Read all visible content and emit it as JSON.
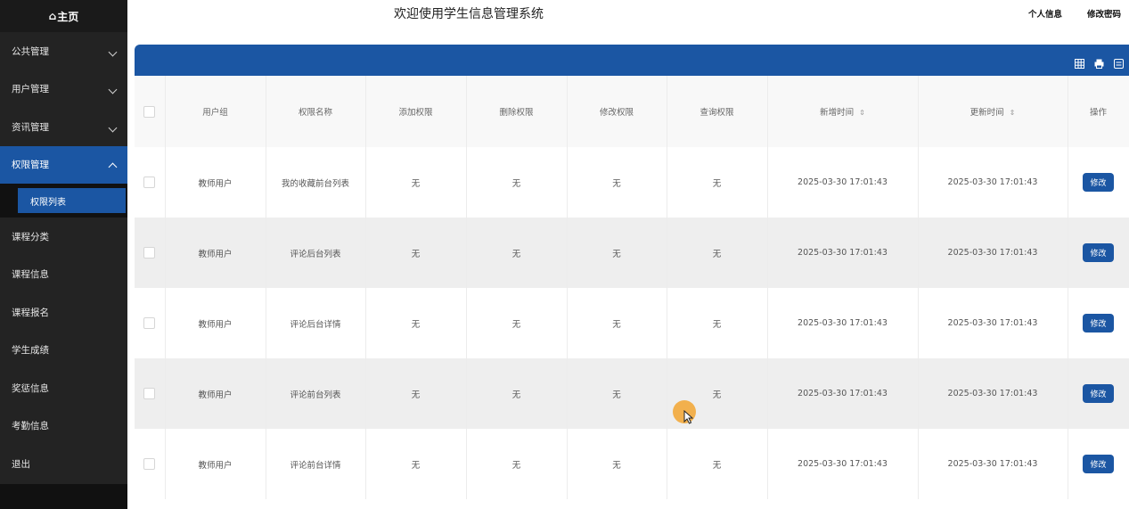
{
  "sidebar": {
    "brand": "主页",
    "menus": [
      {
        "label": "公共管理"
      },
      {
        "label": "用户管理"
      },
      {
        "label": "资讯管理"
      },
      {
        "label": "权限管理"
      }
    ],
    "submenu_active": "权限列表",
    "plain_items": [
      {
        "label": "课程分类"
      },
      {
        "label": "课程信息"
      },
      {
        "label": "课程报名"
      },
      {
        "label": "学生成绩"
      },
      {
        "label": "奖惩信息"
      },
      {
        "label": "考勤信息"
      },
      {
        "label": "退出"
      }
    ]
  },
  "header": {
    "title": "欢迎使用学生信息管理系统",
    "profile_link": "个人信息",
    "password_link": "修改密码"
  },
  "toolbar": {
    "icons": [
      "table-icon",
      "print-icon",
      "export-icon"
    ]
  },
  "table": {
    "columns": [
      "用户组",
      "权限名称",
      "添加权限",
      "删除权限",
      "修改权限",
      "查询权限",
      "新增时间",
      "更新时间",
      "操作"
    ],
    "rows": [
      {
        "group": "教师用户",
        "name": "我的收藏前台列表",
        "add": "无",
        "del": "无",
        "edit": "无",
        "query": "无",
        "created": "2025-03-30 17:01:43",
        "updated": "2025-03-30 17:01:43",
        "action": "修改"
      },
      {
        "group": "教师用户",
        "name": "评论后台列表",
        "add": "无",
        "del": "无",
        "edit": "无",
        "query": "无",
        "created": "2025-03-30 17:01:43",
        "updated": "2025-03-30 17:01:43",
        "action": "修改"
      },
      {
        "group": "教师用户",
        "name": "评论后台详情",
        "add": "无",
        "del": "无",
        "edit": "无",
        "query": "无",
        "created": "2025-03-30 17:01:43",
        "updated": "2025-03-30 17:01:43",
        "action": "修改"
      },
      {
        "group": "教师用户",
        "name": "评论前台列表",
        "add": "无",
        "del": "无",
        "edit": "无",
        "query": "无",
        "created": "2025-03-30 17:01:43",
        "updated": "2025-03-30 17:01:43",
        "action": "修改"
      },
      {
        "group": "教师用户",
        "name": "评论前台详情",
        "add": "无",
        "del": "无",
        "edit": "无",
        "query": "无",
        "created": "2025-03-30 17:01:43",
        "updated": "2025-03-30 17:01:43",
        "action": "修改"
      }
    ]
  },
  "colors": {
    "accent": "#1b56a3",
    "sidebar_bg": "#232323",
    "cursor_highlight": "#f2a93b"
  }
}
